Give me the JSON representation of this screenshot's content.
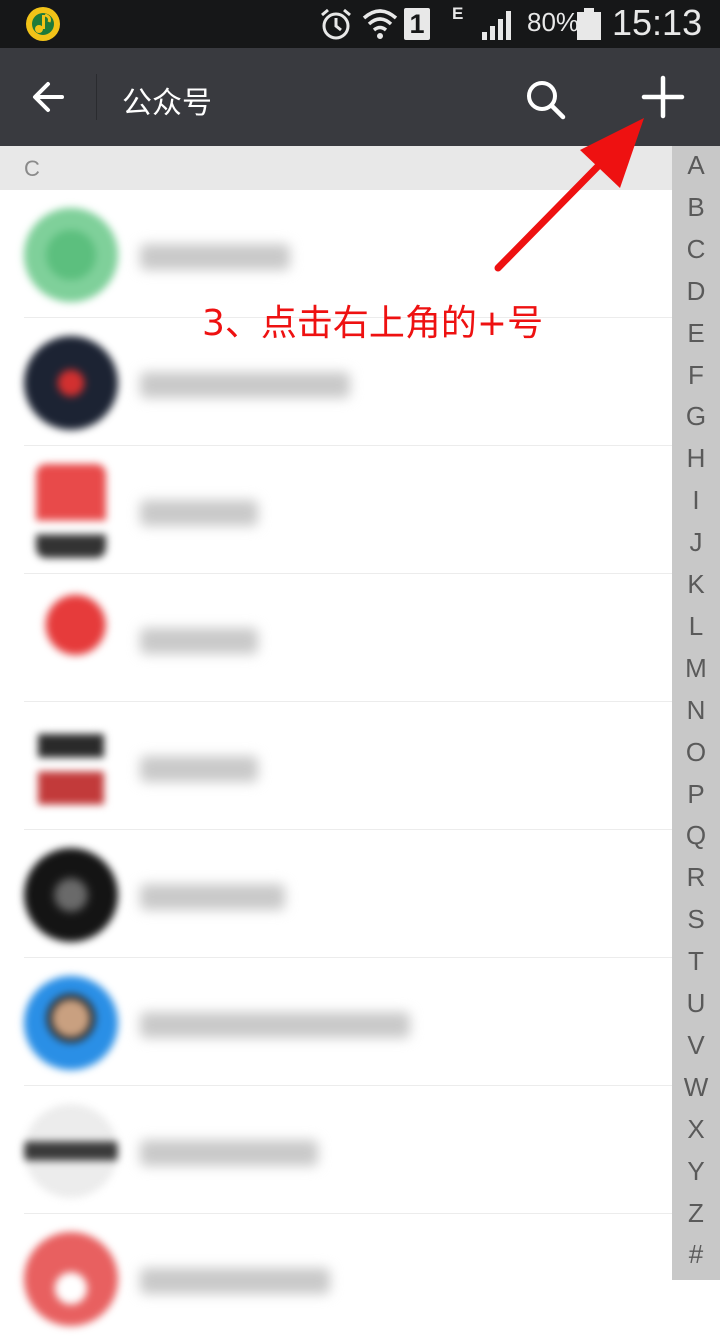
{
  "status_bar": {
    "app_icon": "music-note-icon",
    "alarm_icon": "alarm-clock-icon",
    "wifi_icon": "wifi-icon",
    "sim_label": "1",
    "network_type": "E",
    "signal_icon": "signal-bars-icon",
    "battery_percent": "80%",
    "battery_level": 0.8,
    "time": "15:13"
  },
  "header": {
    "title": "公众号",
    "back_icon": "arrow-left-icon",
    "search_icon": "search-icon",
    "add_icon": "plus-icon",
    "background": "#393a3f"
  },
  "section": {
    "letter": "C"
  },
  "list": {
    "items": [
      {
        "avatar_color": "#5cbf7e",
        "blurred": true
      },
      {
        "avatar_color": "#1c2333",
        "blurred": true
      },
      {
        "avatar_color": "#e84a4a",
        "blurred": true
      },
      {
        "avatar_color": "#e63b3b",
        "blurred": true
      },
      {
        "avatar_color": "#b83a3a",
        "blurred": true
      },
      {
        "avatar_color": "#1a1a1a",
        "blurred": true
      },
      {
        "avatar_color": "#2a8fe6",
        "blurred": true
      },
      {
        "avatar_color": "#3a3a3a",
        "blurred": true
      },
      {
        "avatar_color": "#e86060",
        "blurred": true
      }
    ]
  },
  "index_bar": {
    "letters": [
      "A",
      "B",
      "C",
      "D",
      "E",
      "F",
      "G",
      "H",
      "I",
      "J",
      "K",
      "L",
      "M",
      "N",
      "O",
      "P",
      "Q",
      "R",
      "S",
      "T",
      "U",
      "V",
      "W",
      "X",
      "Y",
      "Z",
      "#"
    ]
  },
  "annotation": {
    "text": "3、点击右上角的+号",
    "color": "#ee1111"
  }
}
